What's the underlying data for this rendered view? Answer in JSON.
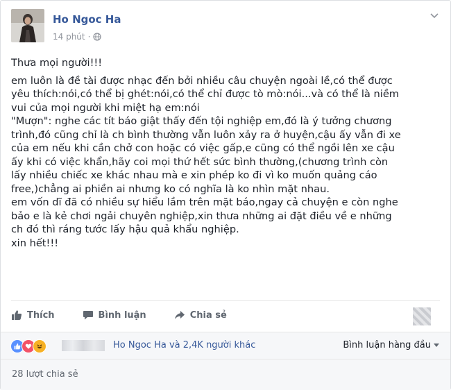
{
  "post": {
    "author": "Ho Ngoc Ha",
    "time": "14 phút",
    "time_separator": "·",
    "privacy_icon": "globe-icon",
    "lines": [
      "Thưa mọi người!!!",
      "em luôn là đề tài được nhạc đến bởi nhiều câu chuyện ngoài lề,có thể được",
      "yêu thích:nói,có thể bị ghét:nói,có thể chỉ được tò mò:nói...và có thể là niềm",
      "vui của mọi người khi miệt hạ em:nói",
      "\"Mượn\": nghe các tít báo giật thấy đến tội nghiệp em,đó là ý tưởng chương",
      "trình,đó cũng chỉ là ch bình thường vẫn luôn xảy ra ở huyện,cậu ấy vẫn đi xe",
      "của em nếu khi cần chở con hoặc có việc gấp,e cũng có thể ngồi lên xe cậu",
      "ấy khi có việc khẩn,hãy coi mọi thứ hết sức bình thường,(chương trình còn",
      "lấy nhiều chiếc xe khác nhau mà e xin phép ko đi vì ko muốn quảng cáo",
      "free,)chẳng ai phiền ai nhưng ko có nghĩa là ko nhìn mặt nhau.",
      "em vốn dĩ đã có nhiều sự hiểu lầm trên mặt báo,ngay cả chuyện e còn nghe",
      "bảo e là kẻ chơi ngải chuyên nghiệp,xin thưa những ai đặt điều về e những",
      "ch đó thì ráng tước lấy hậu quả khẩu nghiệp.",
      "xin hết!!!"
    ]
  },
  "actions": {
    "like": "Thích",
    "comment": "Bình luận",
    "share": "Chia sẻ"
  },
  "reactions": {
    "text": "Ho Ngoc Ha và 2,4K người khác",
    "types": [
      "like-icon",
      "love-icon",
      "haha-icon"
    ],
    "colors": {
      "like": "#5890ff",
      "love": "#f25268",
      "haha": "#f7b125"
    }
  },
  "comments_filter": "Bình luận hàng đầu",
  "shares": "28 lượt chia sẻ",
  "colors": {
    "link": "#365899",
    "muted": "#90949c",
    "text": "#1d2129"
  }
}
